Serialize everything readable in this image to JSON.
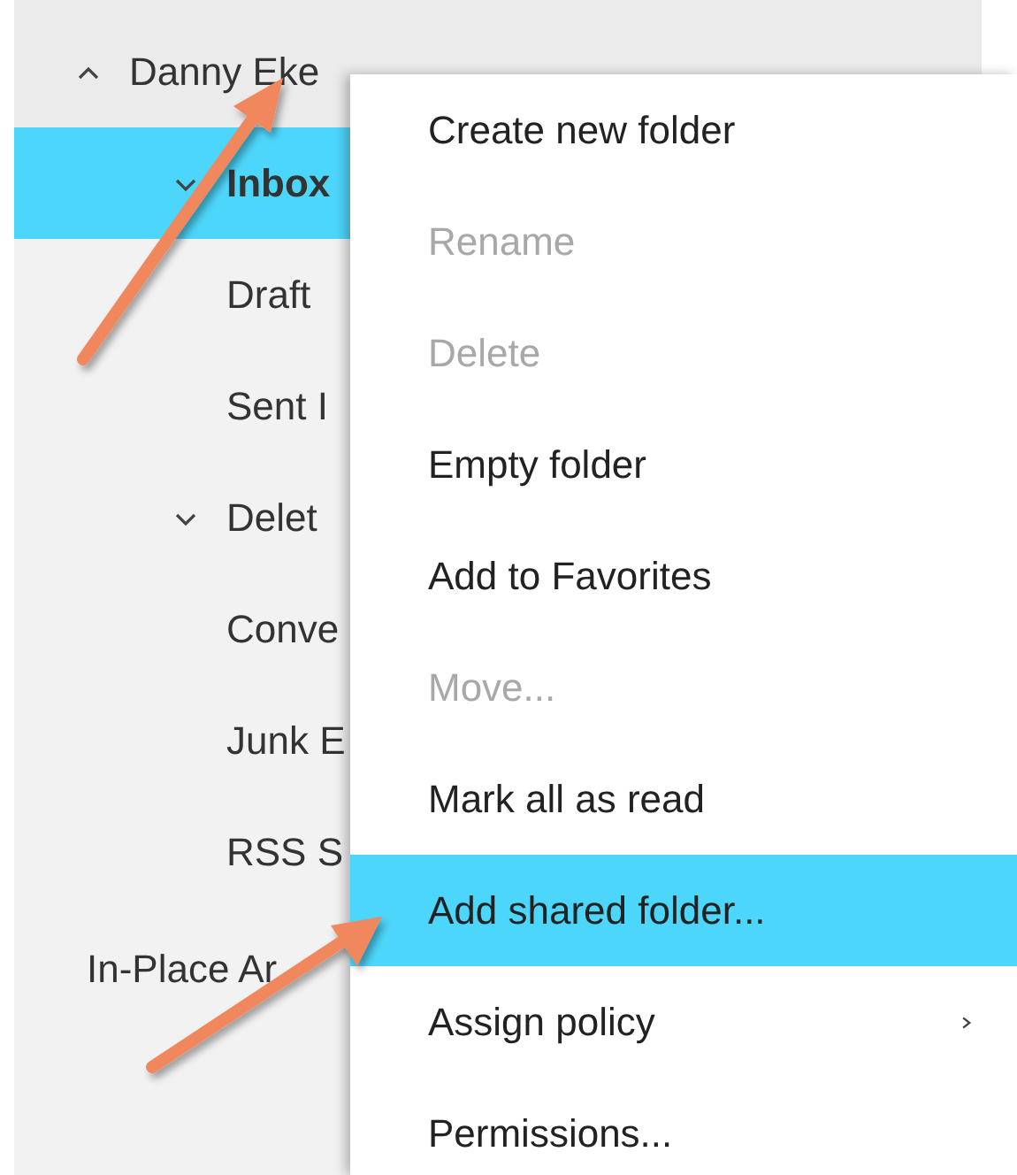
{
  "folder_tree": [
    {
      "label": "Danny Eke",
      "kind": "account",
      "expanded": true,
      "selected": false,
      "children": [
        {
          "label": "Inbox",
          "kind": "folder",
          "expanded": true,
          "selected": true
        },
        {
          "label": "Draft",
          "kind": "folder",
          "selected": false
        },
        {
          "label": "Sent I",
          "kind": "folder",
          "selected": false
        },
        {
          "label": "Delet",
          "kind": "folder",
          "expanded": true,
          "selected": false
        },
        {
          "label": "Conve",
          "kind": "folder",
          "selected": false
        },
        {
          "label": "Junk E",
          "kind": "folder",
          "selected": false
        },
        {
          "label": "RSS S",
          "kind": "folder",
          "selected": false
        }
      ]
    },
    {
      "label": "In-Place Ar",
      "kind": "archive",
      "selected": false
    }
  ],
  "context_menu": [
    {
      "label": "Create new folder",
      "disabled": false,
      "selected": false
    },
    {
      "label": "Rename",
      "disabled": true,
      "selected": false
    },
    {
      "label": "Delete",
      "disabled": true,
      "selected": false
    },
    {
      "label": "Empty folder",
      "disabled": false,
      "selected": false
    },
    {
      "label": "Add to Favorites",
      "disabled": false,
      "selected": false
    },
    {
      "label": "Move...",
      "disabled": true,
      "selected": false
    },
    {
      "label": "Mark all as read",
      "disabled": false,
      "selected": false
    },
    {
      "label": "Add shared folder...",
      "disabled": false,
      "selected": true
    },
    {
      "label": "Assign policy",
      "disabled": false,
      "selected": false,
      "submenu": true
    },
    {
      "label": "Permissions...",
      "disabled": false,
      "selected": false
    }
  ]
}
